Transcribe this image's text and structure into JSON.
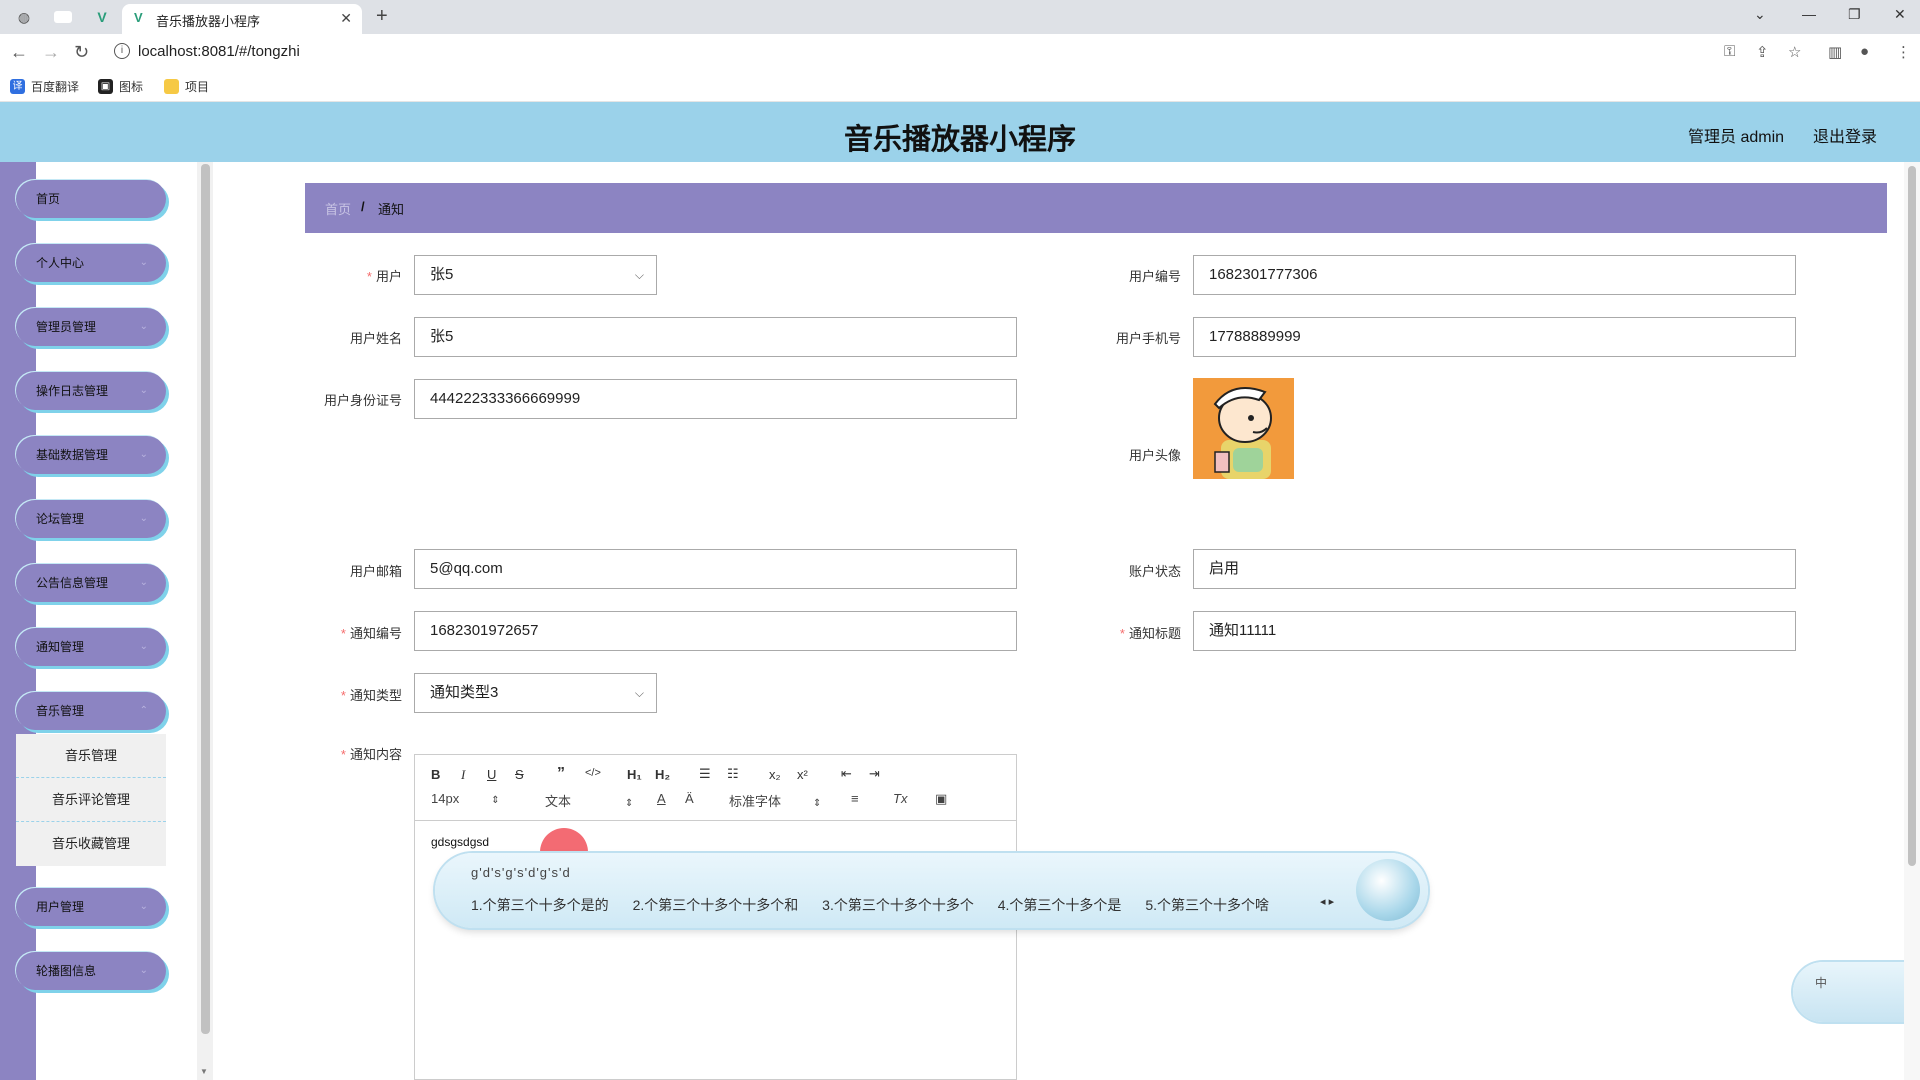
{
  "browser": {
    "tab_title": "音乐播放器小程序",
    "url": "localhost:8081/#/tongzhi",
    "bookmarks": [
      "百度翻译",
      "图标",
      "项目"
    ]
  },
  "header": {
    "title": "音乐播放器小程序",
    "user": "管理员 admin",
    "logout": "退出登录"
  },
  "sidebar": {
    "items": [
      "首页",
      "个人中心",
      "管理员管理",
      "操作日志管理",
      "基础数据管理",
      "论坛管理",
      "公告信息管理",
      "通知管理",
      "音乐管理",
      "用户管理",
      "轮播图信息"
    ],
    "submenu": [
      "音乐管理",
      "音乐评论管理",
      "音乐收藏管理"
    ]
  },
  "breadcrumb": {
    "home": "首页",
    "separator": "/",
    "current": "通知"
  },
  "form": {
    "user_label": "用户",
    "user_value": "张5",
    "user_no_label": "用户编号",
    "user_no_value": "1682301777306",
    "user_name_label": "用户姓名",
    "user_name_value": "张5",
    "user_phone_label": "用户手机号",
    "user_phone_value": "17788889999",
    "user_id_label": "用户身份证号",
    "user_id_value": "444222333366669999",
    "user_avatar_label": "用户头像",
    "user_email_label": "用户邮箱",
    "user_email_value": "5@qq.com",
    "account_status_label": "账户状态",
    "account_status_value": "启用",
    "notice_no_label": "通知编号",
    "notice_no_value": "1682301972657",
    "notice_title_label": "通知标题",
    "notice_title_value": "通知11111",
    "notice_type_label": "通知类型",
    "notice_type_value": "通知类型3",
    "notice_content_label": "通知内容"
  },
  "editor": {
    "font_size": "14px",
    "block_type": "文本",
    "font_family": "标准字体",
    "content": "gdsgsdgsd"
  },
  "ime": {
    "composition": "g'd's'g's'd'g's'd",
    "candidates": [
      "1.个第三个十多个是的",
      "2.个第三个十多个十多个和",
      "3.个第三个十多个十多个",
      "4.个第三个十多个是",
      "5.个第三个十多个啥"
    ],
    "mode": "中"
  },
  "colors": {
    "header": "#9bd2ea",
    "sidebar": "#8c84c2",
    "accent_glow": "#7fd2ea",
    "required": "#f56c6c"
  }
}
